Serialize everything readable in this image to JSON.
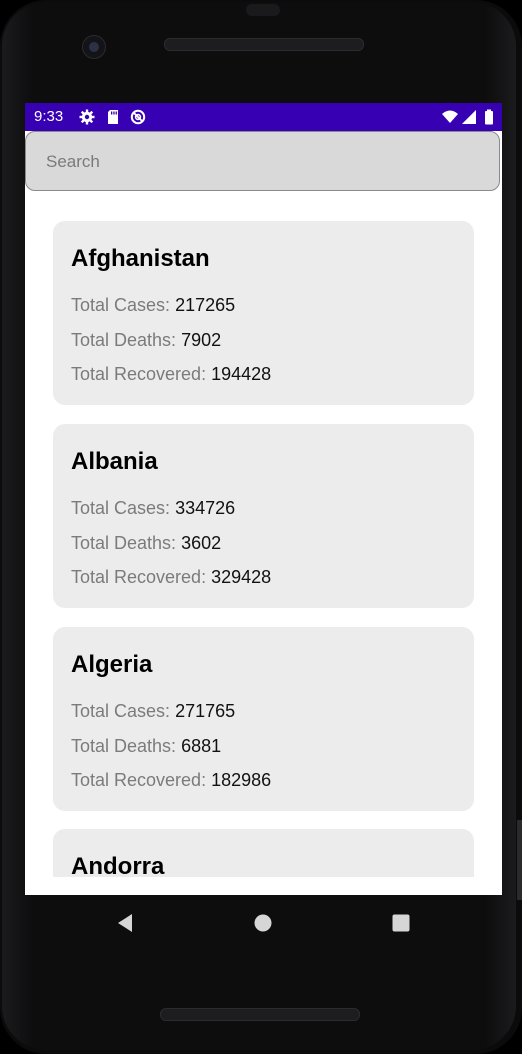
{
  "status_bar": {
    "time": "9:33",
    "left_icons": [
      "gear-icon",
      "sd-card-icon",
      "sync-disabled-icon"
    ],
    "right_icons": [
      "wifi-icon",
      "signal-icon",
      "battery-icon"
    ],
    "color": "#3700b3"
  },
  "search": {
    "placeholder": "Search",
    "value": ""
  },
  "countries": [
    {
      "name": "Afghanistan",
      "cases_label": "Total Cases:",
      "cases": "217265",
      "deaths_label": "Total Deaths:",
      "deaths": "7902",
      "recovered_label": "Total Recovered:",
      "recovered": "194428"
    },
    {
      "name": "Albania",
      "cases_label": "Total Cases:",
      "cases": "334726",
      "deaths_label": "Total Deaths:",
      "deaths": "3602",
      "recovered_label": "Total Recovered:",
      "recovered": "329428"
    },
    {
      "name": "Algeria",
      "cases_label": "Total Cases:",
      "cases": "271765",
      "deaths_label": "Total Deaths:",
      "deaths": "6881",
      "recovered_label": "Total Recovered:",
      "recovered": "182986"
    },
    {
      "name": "Andorra"
    }
  ],
  "nav": {
    "buttons": [
      "back-icon",
      "home-icon",
      "recents-icon"
    ]
  }
}
